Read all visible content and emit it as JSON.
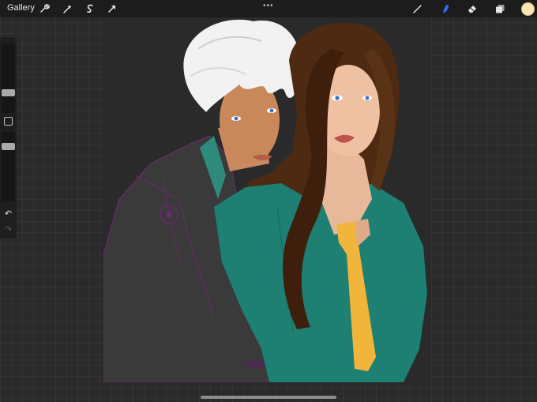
{
  "topbar": {
    "gallery_label": "Gallery",
    "more_label": "•••"
  },
  "tools": {
    "left": [
      "wrench-icon",
      "magic-wand-icon",
      "selection-icon",
      "transform-arrow-icon"
    ],
    "right": [
      "brush-icon",
      "smudge-icon",
      "eraser-icon",
      "layers-icon"
    ]
  },
  "colors": {
    "active_tool": "#2f6fe6",
    "current_color": "#fbe7b2"
  },
  "sidebar": {
    "undo_label": "↶",
    "redo_label": "↷"
  }
}
